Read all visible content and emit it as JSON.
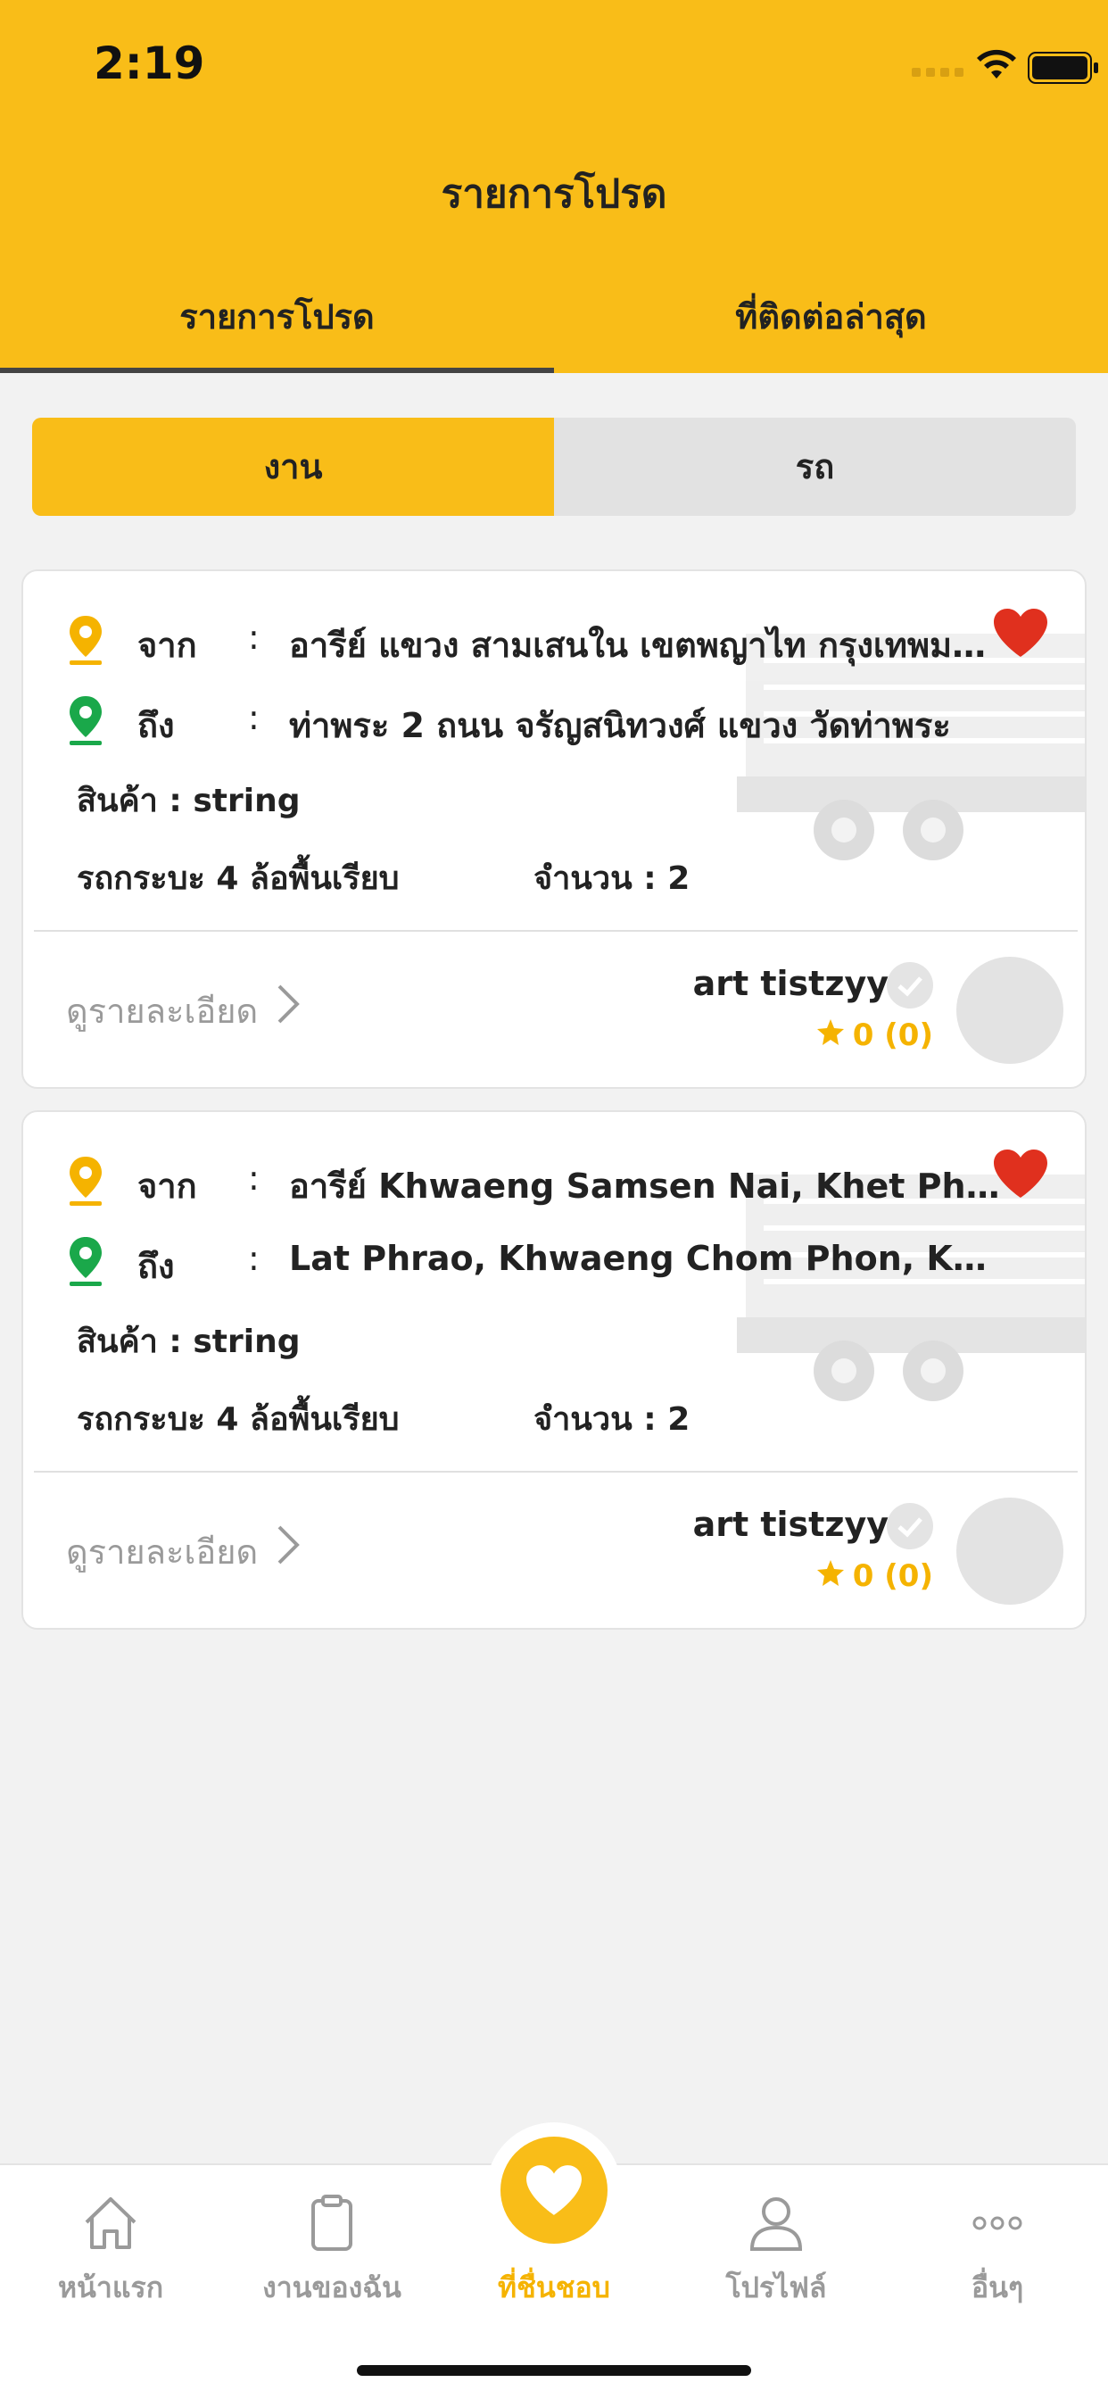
{
  "status": {
    "time": "2:19"
  },
  "nav": {
    "title": "รายการโปรด"
  },
  "tabs": [
    {
      "label": "รายการโปรด",
      "active": true
    },
    {
      "label": "ที่ติดต่อล่าสุด",
      "active": false
    }
  ],
  "segment": [
    {
      "label": "งาน",
      "active": true
    },
    {
      "label": "รถ",
      "active": false
    }
  ],
  "cards": [
    {
      "from_label": "จาก",
      "from": "อารีย์ แขวง สามเสนใน เขตพญาไท กรุงเทพมหานคร",
      "to_label": "ถึง",
      "to": "ท่าพระ 2 ถนน จรัญสนิทวงศ์ แขวง วัดท่าพระ",
      "colon": ":",
      "goods": "สินค้า : string",
      "vehicle": "รถกระบะ 4 ล้อพื้นเรียบ",
      "quantity": "จำนวน : 2",
      "details": "ดูรายละเอียด",
      "user": "art tistzyy",
      "rating": "0 (0)",
      "favorited": true
    },
    {
      "from_label": "จาก",
      "from": "อารีย์ Khwaeng Samsen Nai, Khet Phaya Thai",
      "to_label": "ถึง",
      "to": "Lat Phrao, Khwaeng Chom Phon, Khet Chatuchak",
      "colon": ":",
      "goods": "สินค้า : string",
      "vehicle": "รถกระบะ 4 ล้อพื้นเรียบ",
      "quantity": "จำนวน : 2",
      "details": "ดูรายละเอียด",
      "user": "art tistzyy",
      "rating": "0 (0)",
      "favorited": true
    }
  ],
  "tabbar": [
    {
      "label": "หน้าแรก",
      "icon": "home-icon"
    },
    {
      "label": "งานของฉัน",
      "icon": "clipboard-icon"
    },
    {
      "label": "ที่ชื่นชอบ",
      "icon": "heart-icon",
      "active": true
    },
    {
      "label": "โปรไฟล์",
      "icon": "user-icon"
    },
    {
      "label": "อื่นๆ",
      "icon": "more-icon"
    }
  ],
  "colors": {
    "brand": "#f9bd18",
    "pin_from": "#f5b300",
    "pin_to": "#1aa84a",
    "heart": "#e0301e"
  }
}
